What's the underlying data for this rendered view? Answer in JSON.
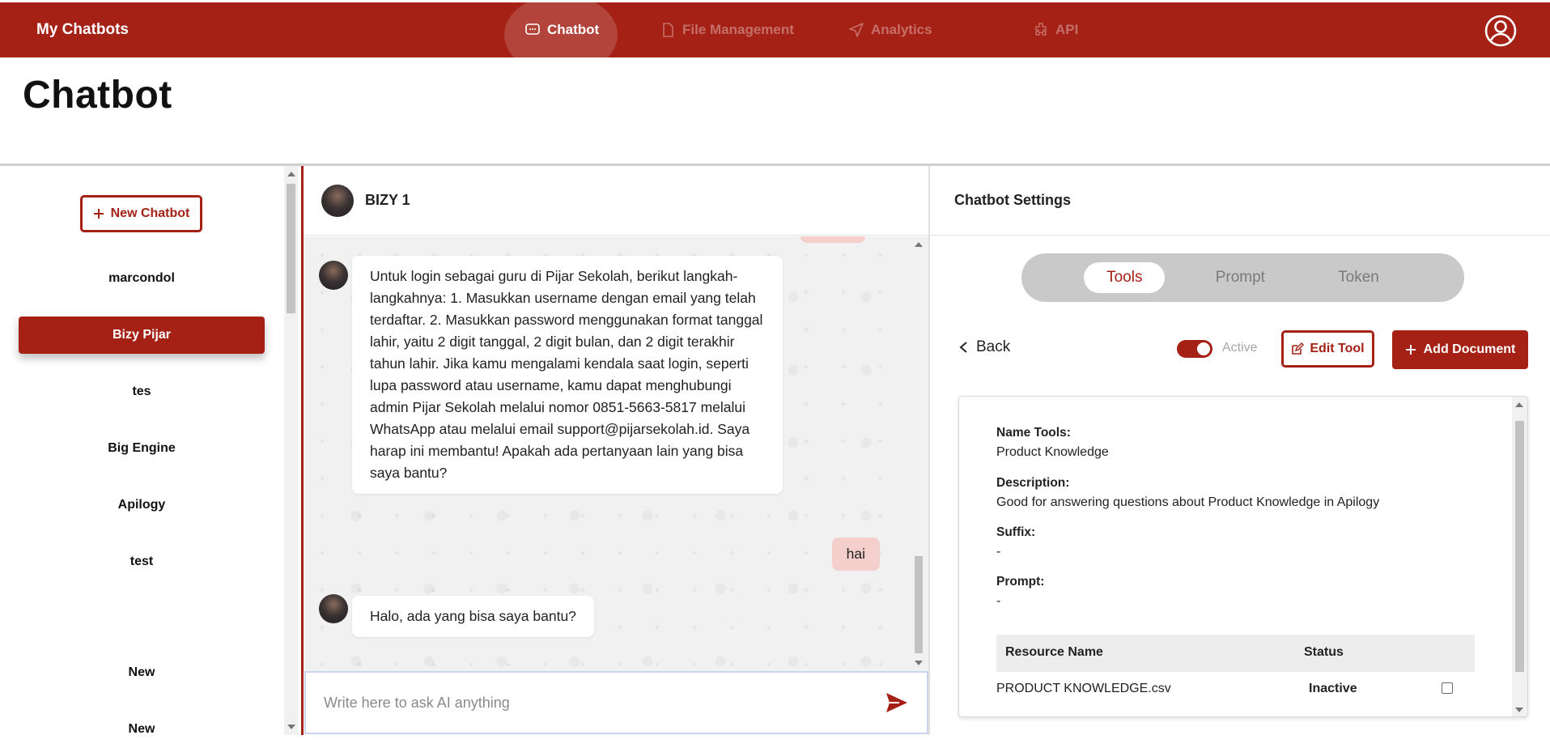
{
  "app": {
    "brand": "My Chatbots"
  },
  "nav": [
    {
      "label": "Chatbot",
      "icon": "chat-bubble-icon",
      "active": true
    },
    {
      "label": "File Management",
      "icon": "file-icon",
      "active": false
    },
    {
      "label": "Analytics",
      "icon": "send-arrow-icon",
      "active": false
    },
    {
      "label": "API",
      "icon": "puzzle-icon",
      "active": false
    }
  ],
  "page": {
    "title": "Chatbot"
  },
  "sidebar": {
    "new_button": "New Chatbot",
    "items": [
      {
        "label": "marcondol",
        "active": false
      },
      {
        "label": "Bizy Pijar",
        "active": true
      },
      {
        "label": "tes",
        "active": false
      },
      {
        "label": "Big Engine",
        "active": false
      },
      {
        "label": "Apilogy",
        "active": false
      },
      {
        "label": "test",
        "active": false
      },
      {
        "label": "",
        "active": false
      },
      {
        "label": "New",
        "active": false
      },
      {
        "label": "New",
        "active": false
      }
    ]
  },
  "chat": {
    "bot_name": "BIZY 1",
    "messages": [
      {
        "from": "bot",
        "text": "Untuk login sebagai guru di Pijar Sekolah, berikut langkah-langkahnya: 1. Masukkan username dengan email yang telah terdaftar. 2. Masukkan password menggunakan format tanggal lahir, yaitu 2 digit tanggal, 2 digit bulan, dan 2 digit terakhir tahun lahir. Jika kamu mengalami kendala saat login, seperti lupa password atau username, kamu dapat menghubungi admin Pijar Sekolah melalui nomor 0851-5663-5817 melalui WhatsApp atau melalui email support@pijarsekolah.id. Saya harap ini membantu! Apakah ada pertanyaan lain yang bisa saya bantu?"
      },
      {
        "from": "user",
        "text": "hai"
      },
      {
        "from": "bot",
        "text": "Halo, ada yang bisa saya bantu?"
      }
    ],
    "input_placeholder": "Write here to ask AI anything"
  },
  "settings": {
    "title": "Chatbot Settings",
    "tabs": [
      {
        "label": "Tools",
        "active": true
      },
      {
        "label": "Prompt",
        "active": false
      },
      {
        "label": "Token",
        "active": false
      }
    ],
    "back": "Back",
    "toggle_label": "Active",
    "toggle_on": true,
    "edit_button": "Edit Tool",
    "add_button": "Add Document",
    "tool": {
      "name_label": "Name Tools:",
      "name_value": "Product Knowledge",
      "desc_label": "Description:",
      "desc_value": "Good for answering questions about Product Knowledge in Apilogy",
      "suffix_label": "Suffix:",
      "suffix_value": "-",
      "prompt_label": "Prompt:",
      "prompt_value": "-"
    },
    "resources": {
      "headers": [
        "Resource Name",
        "Status"
      ],
      "rows": [
        {
          "name": "PRODUCT KNOWLEDGE.csv",
          "status": "Inactive",
          "checked": false
        }
      ]
    }
  },
  "colors": {
    "brand": "#a52116",
    "user_bubble": "#f4cfcc",
    "tabs_bg": "#c9c9c9"
  }
}
